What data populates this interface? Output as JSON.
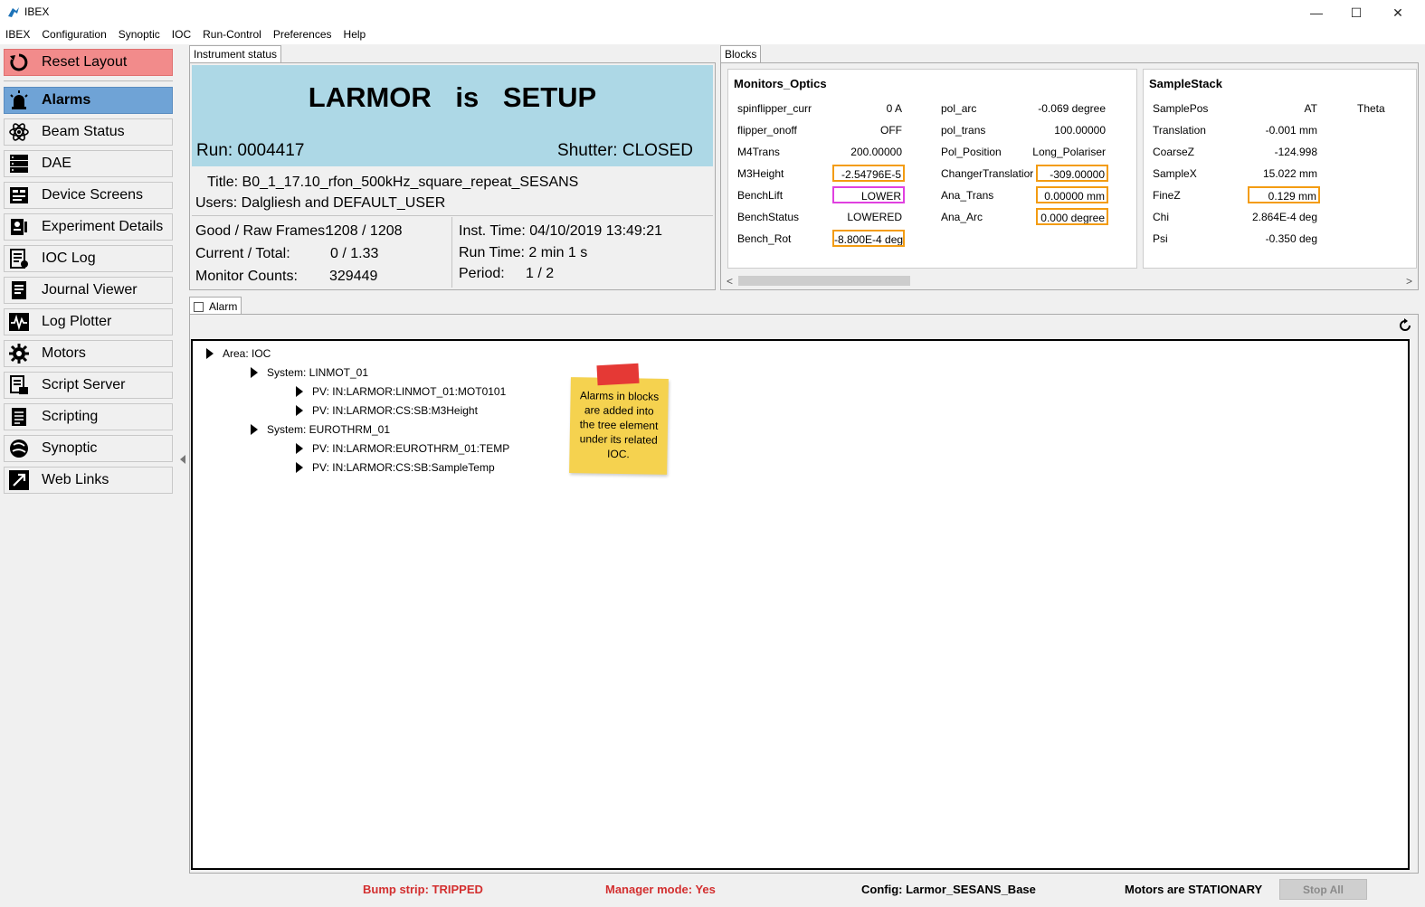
{
  "window": {
    "title": "IBEX",
    "controls": [
      "—",
      "☐",
      "✕"
    ]
  },
  "menu": [
    "IBEX",
    "Configuration",
    "Synoptic",
    "IOC",
    "Run-Control",
    "Preferences",
    "Help"
  ],
  "sidebar": {
    "reset_label": "Reset Layout",
    "items": [
      {
        "label": "Alarms",
        "icon": "alarm-siren-icon",
        "active": true
      },
      {
        "label": "Beam Status",
        "icon": "atom-icon"
      },
      {
        "label": "DAE",
        "icon": "dae-server-icon"
      },
      {
        "label": "Device Screens",
        "icon": "device-screens-icon"
      },
      {
        "label": "Experiment Details",
        "icon": "experiment-details-icon"
      },
      {
        "label": "IOC Log",
        "icon": "ioc-log-icon"
      },
      {
        "label": "Journal Viewer",
        "icon": "journal-icon"
      },
      {
        "label": "Log Plotter",
        "icon": "log-plotter-icon"
      },
      {
        "label": "Motors",
        "icon": "gear-icon"
      },
      {
        "label": "Script Server",
        "icon": "script-server-icon"
      },
      {
        "label": "Scripting",
        "icon": "scripting-icon"
      },
      {
        "label": "Synoptic",
        "icon": "synoptic-icon"
      },
      {
        "label": "Web Links",
        "icon": "web-links-icon"
      }
    ]
  },
  "instrument_status": {
    "tab_label": "Instrument status",
    "headline": "LARMOR is SETUP",
    "run": "Run: 0004417",
    "shutter": "Shutter: CLOSED",
    "title": "Title: B0_1_17.10_rfon_500kHz_square_repeat_SESANS",
    "users": "Users: Dalgliesh and DEFAULT_USER",
    "good_raw_label": "Good / Raw Frames:",
    "good_raw_value": "1208 / 1208",
    "current_total_label": "Current / Total:",
    "current_total_value": "0 / 1.33",
    "monitor_label": "Monitor Counts:",
    "monitor_value": "329449",
    "inst_time": "Inst. Time: 04/10/2019 13:49:21",
    "run_time": "Run Time: 2 min 1 s",
    "period_label": "Period:",
    "period_value": "1 / 2"
  },
  "blocks": {
    "tab_label": "Blocks",
    "monitors_optics": {
      "title": "Monitors_Optics",
      "col1": [
        {
          "name": "spinflipper_curr",
          "value": "0 A"
        },
        {
          "name": "flipper_onoff",
          "value": "OFF"
        },
        {
          "name": "M4Trans",
          "value": "200.00000"
        },
        {
          "name": "M3Height",
          "value": "-2.54796E-5",
          "alarm": "orange"
        },
        {
          "name": "BenchLift",
          "value": "LOWER",
          "alarm": "magenta"
        },
        {
          "name": "BenchStatus",
          "value": "LOWERED"
        },
        {
          "name": "Bench_Rot",
          "value": "-8.800E-4 deg",
          "alarm": "orange"
        }
      ],
      "col2": [
        {
          "name": "pol_arc",
          "value": "-0.069 degree"
        },
        {
          "name": "pol_trans",
          "value": "100.00000"
        },
        {
          "name": "Pol_Position",
          "value": "Long_Polariser"
        },
        {
          "name": "ChangerTranslatior",
          "value": "-309.00000",
          "alarm": "orange"
        },
        {
          "name": "Ana_Trans",
          "value": "0.00000 mm",
          "alarm": "orange"
        },
        {
          "name": "Ana_Arc",
          "value": "0.000 degree",
          "alarm": "orange"
        }
      ]
    },
    "sample_stack": {
      "title": "SampleStack",
      "rows": [
        {
          "name": "SamplePos",
          "value": "AT"
        },
        {
          "name": "Translation",
          "value": "-0.001 mm"
        },
        {
          "name": "CoarseZ",
          "value": "-124.998"
        },
        {
          "name": "SampleX",
          "value": "15.022 mm"
        },
        {
          "name": "FineZ",
          "value": "0.129 mm",
          "alarm": "orange"
        },
        {
          "name": "Chi",
          "value": "2.864E-4 deg"
        },
        {
          "name": "Psi",
          "value": "-0.350 deg"
        }
      ],
      "extra_col": "Theta"
    },
    "scroll_left": "<",
    "scroll_right": ">"
  },
  "alarm": {
    "tab_label": "Alarm",
    "tree": [
      {
        "text": "Area: IOC",
        "level": 0
      },
      {
        "text": "System: LINMOT_01",
        "level": 1
      },
      {
        "text": "PV: IN:LARMOR:LINMOT_01:MOT0101",
        "level": 2
      },
      {
        "text": "PV: IN:LARMOR:CS:SB:M3Height",
        "level": 2
      },
      {
        "text": "System: EUROTHRM_01",
        "level": 1
      },
      {
        "text": "PV: IN:LARMOR:EUROTHRM_01:TEMP",
        "level": 2
      },
      {
        "text": "PV: IN:LARMOR:CS:SB:SampleTemp",
        "level": 2
      }
    ],
    "note": "Alarms in blocks are added into the tree element under its related IOC."
  },
  "status": {
    "bump_strip": "Bump strip: TRIPPED",
    "manager_mode": "Manager mode: Yes",
    "config": "Config: Larmor_SESANS_Base",
    "motors": "Motors are STATIONARY",
    "stop_all": "Stop All"
  },
  "colors": {
    "reset": "#f28b8b",
    "active": "#6fa3d6",
    "instrument_banner": "#add8e6",
    "alarm_orange": "#f39c12",
    "alarm_magenta": "#e040e0",
    "status_red": "#d32f2f"
  }
}
